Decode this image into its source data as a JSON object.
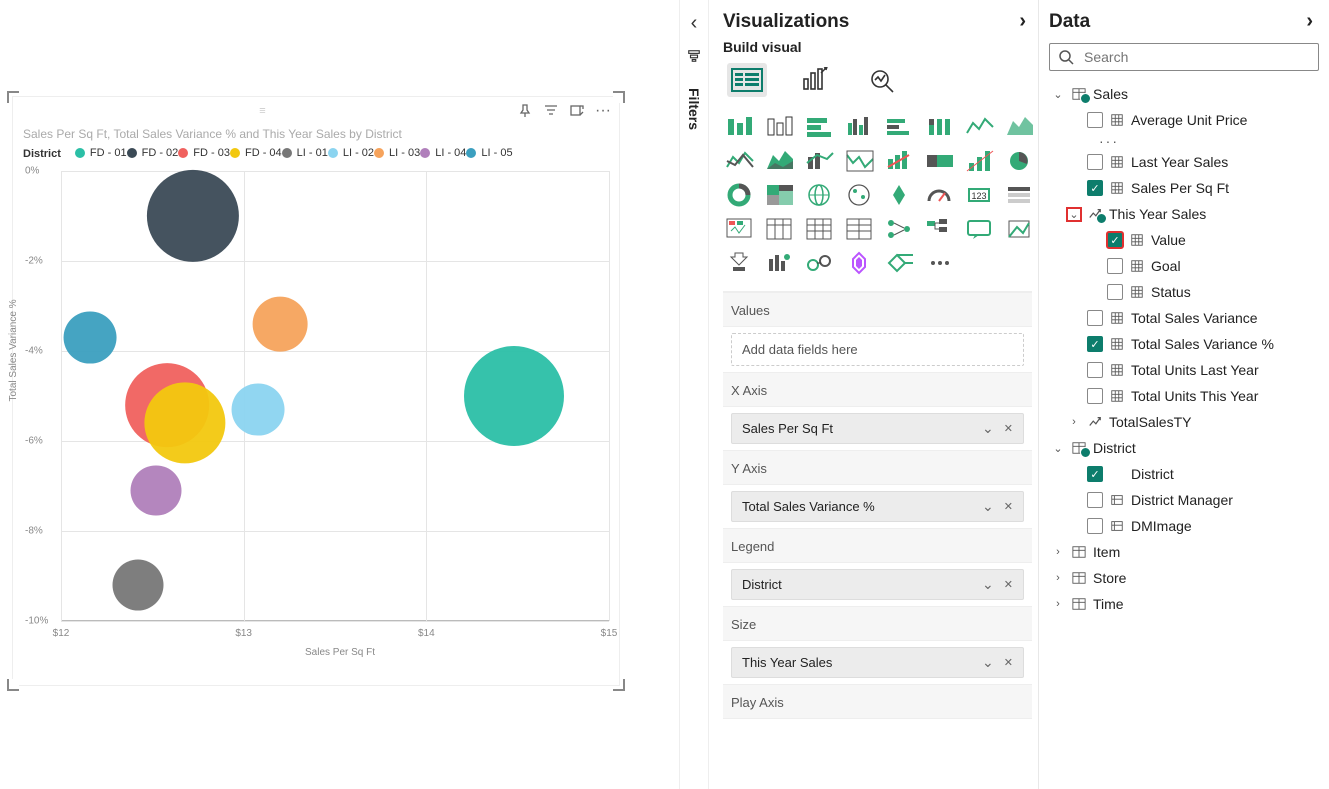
{
  "panes": {
    "filters": {
      "label": "Filters"
    },
    "viz": {
      "title": "Visualizations",
      "subtitle": "Build visual"
    },
    "data": {
      "title": "Data",
      "search_placeholder": "Search"
    }
  },
  "chart": {
    "title": "Sales Per Sq Ft, Total Sales Variance % and This Year Sales by District",
    "legend_title": "District",
    "xlabel": "Sales Per Sq Ft",
    "ylabel": "Total Sales Variance %",
    "legend": [
      {
        "name": "FD - 01",
        "color": "#2bbfa6"
      },
      {
        "name": "FD - 02",
        "color": "#3b4a56"
      },
      {
        "name": "FD - 03",
        "color": "#f0615e"
      },
      {
        "name": "FD - 04",
        "color": "#f2c80f"
      },
      {
        "name": "LI - 01",
        "color": "#777777"
      },
      {
        "name": "LI - 02",
        "color": "#8bd4f0"
      },
      {
        "name": "LI - 03",
        "color": "#f6a35c"
      },
      {
        "name": "LI - 04",
        "color": "#b07fbb"
      },
      {
        "name": "LI - 05",
        "color": "#3b9fbf"
      }
    ]
  },
  "chart_data": {
    "type": "scatter",
    "title": "Sales Per Sq Ft, Total Sales Variance % and This Year Sales by District",
    "xlabel": "Sales Per Sq Ft",
    "ylabel": "Total Sales Variance %",
    "size_field": "This Year Sales",
    "color_field": "District",
    "xlim": [
      12,
      15
    ],
    "ylim": [
      -10,
      0
    ],
    "x_ticks": [
      12,
      13,
      14,
      15
    ],
    "y_ticks": [
      0,
      -2,
      -4,
      -6,
      -8,
      -10
    ],
    "series": [
      {
        "name": "FD - 01",
        "color": "#2bbfa6",
        "x": 14.48,
        "y": -5.0,
        "size": 100
      },
      {
        "name": "FD - 02",
        "color": "#3b4a56",
        "x": 12.72,
        "y": -1.0,
        "size": 85
      },
      {
        "name": "FD - 03",
        "color": "#f0615e",
        "x": 12.58,
        "y": -5.2,
        "size": 70
      },
      {
        "name": "FD - 04",
        "color": "#f2c80f",
        "x": 12.68,
        "y": -5.6,
        "size": 66
      },
      {
        "name": "LI - 01",
        "color": "#777777",
        "x": 12.42,
        "y": -9.2,
        "size": 26
      },
      {
        "name": "LI - 02",
        "color": "#8bd4f0",
        "x": 13.08,
        "y": -5.3,
        "size": 28
      },
      {
        "name": "LI - 03",
        "color": "#f6a35c",
        "x": 13.2,
        "y": -3.4,
        "size": 30
      },
      {
        "name": "LI - 04",
        "color": "#b07fbb",
        "x": 12.52,
        "y": -7.1,
        "size": 26
      },
      {
        "name": "LI - 05",
        "color": "#3b9fbf",
        "x": 12.16,
        "y": -3.7,
        "size": 28
      }
    ]
  },
  "wells": {
    "values": {
      "label": "Values",
      "placeholder": "Add data fields here"
    },
    "xaxis": {
      "label": "X Axis",
      "field": "Sales Per Sq Ft"
    },
    "yaxis": {
      "label": "Y Axis",
      "field": "Total Sales Variance %"
    },
    "legend": {
      "label": "Legend",
      "field": "District"
    },
    "size": {
      "label": "Size",
      "field": "This Year Sales"
    },
    "playaxis": {
      "label": "Play Axis"
    }
  },
  "data_tree": {
    "sales": {
      "name": "Sales",
      "avg_unit_price": "Average Unit Price",
      "last_year_sales": "Last Year Sales",
      "sales_per_sqft": "Sales Per Sq Ft",
      "this_year_sales": "This Year Sales",
      "value": "Value",
      "goal": "Goal",
      "status": "Status",
      "total_sales_variance": "Total Sales Variance",
      "total_sales_variance_pct": "Total Sales Variance %",
      "total_units_last_year": "Total Units Last Year",
      "total_units_this_year": "Total Units This Year",
      "total_sales_ty": "TotalSalesTY"
    },
    "district": {
      "name": "District",
      "district": "District",
      "district_manager": "District Manager",
      "dmimage": "DMImage"
    },
    "item": {
      "name": "Item"
    },
    "store": {
      "name": "Store"
    },
    "time": {
      "name": "Time"
    }
  }
}
